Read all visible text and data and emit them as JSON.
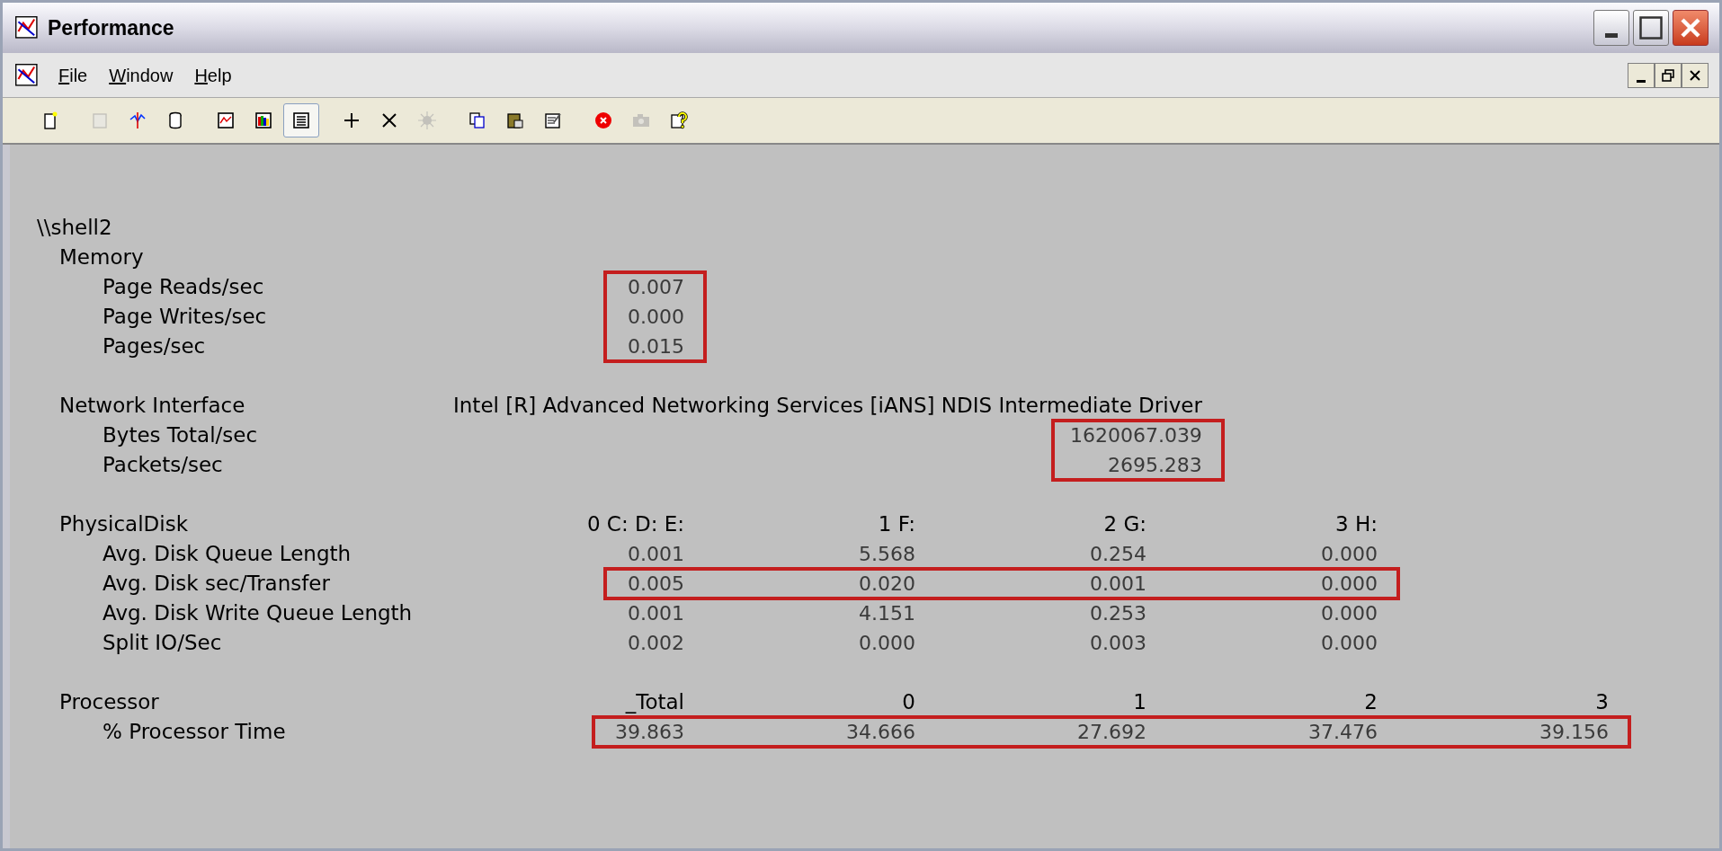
{
  "window": {
    "title": "Performance"
  },
  "menu": [
    {
      "label": "File"
    },
    {
      "label": "Window"
    },
    {
      "label": "Help"
    }
  ],
  "toolbar": [
    {
      "disabled": false,
      "selected": false
    },
    {
      "disabled": true,
      "selected": false
    },
    {
      "disabled": false,
      "selected": false
    },
    {
      "disabled": false,
      "selected": false
    },
    {
      "disabled": false,
      "selected": false
    },
    {
      "disabled": false,
      "selected": false
    },
    {
      "disabled": false,
      "selected": true
    },
    {
      "disabled": false,
      "selected": false
    },
    {
      "disabled": false,
      "selected": false
    },
    {
      "disabled": true,
      "selected": false
    },
    {
      "disabled": false,
      "selected": false
    },
    {
      "disabled": false,
      "selected": false
    },
    {
      "disabled": false,
      "selected": false
    },
    {
      "disabled": false,
      "selected": false
    },
    {
      "disabled": true,
      "selected": false
    },
    {
      "disabled": false,
      "selected": false
    }
  ],
  "report": {
    "computer": "\\\\shell2",
    "objects": [
      {
        "name": "Memory",
        "counters": [
          {
            "name": "Page Reads/sec",
            "values": [
              "0.007"
            ],
            "highlighted": true
          },
          {
            "name": "Page Writes/sec",
            "values": [
              "0.000"
            ],
            "highlighted": true
          },
          {
            "name": "Pages/sec",
            "values": [
              "0.015"
            ],
            "highlighted": true
          }
        ]
      },
      {
        "name": "Network Interface",
        "instances": [
          "Intel [R] Advanced Networking Services [iANS] NDIS Intermediate Driver"
        ],
        "counters": [
          {
            "name": "Bytes Total/sec",
            "values": [
              "1620067.039"
            ],
            "highlighted": true
          },
          {
            "name": "Packets/sec",
            "values": [
              "2695.283"
            ],
            "highlighted": true
          }
        ]
      },
      {
        "name": "PhysicalDisk",
        "instances": [
          "0 C: D: E:",
          "1 F:",
          "2 G:",
          "3 H:"
        ],
        "counters": [
          {
            "name": "Avg. Disk Queue Length",
            "values": [
              "0.001",
              "5.568",
              "0.254",
              "0.000"
            ],
            "highlighted": false
          },
          {
            "name": "Avg. Disk sec/Transfer",
            "values": [
              "0.005",
              "0.020",
              "0.001",
              "0.000"
            ],
            "highlighted": true
          },
          {
            "name": "Avg. Disk Write Queue Length",
            "values": [
              "0.001",
              "4.151",
              "0.253",
              "0.000"
            ],
            "highlighted": false
          },
          {
            "name": "Split IO/Sec",
            "values": [
              "0.002",
              "0.000",
              "0.003",
              "0.000"
            ],
            "highlighted": false
          }
        ]
      },
      {
        "name": "Processor",
        "instances": [
          "_Total",
          "0",
          "1",
          "2",
          "3"
        ],
        "counters": [
          {
            "name": "% Processor Time",
            "values": [
              "39.863",
              "34.666",
              "27.692",
              "37.476",
              "39.156"
            ],
            "highlighted": true
          }
        ]
      }
    ]
  }
}
